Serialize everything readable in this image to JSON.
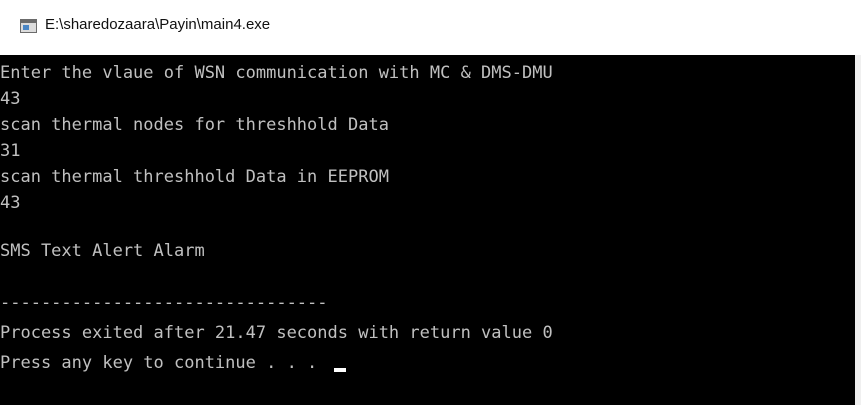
{
  "window": {
    "title": "E:\\sharedozaara\\Payin\\main4.exe",
    "icon": "console-app-icon"
  },
  "console": {
    "lines": [
      "Enter the vlaue of WSN communication with MC & DMS-DMU",
      "43",
      "scan thermal nodes for threshhold Data",
      "31",
      "scan thermal threshhold Data in EEPROM",
      "43",
      "",
      "SMS Text Alert Alarm",
      "",
      "--------------------------------",
      "Process exited after 21.47 seconds with return value 0",
      "Press any key to continue . . . "
    ]
  }
}
